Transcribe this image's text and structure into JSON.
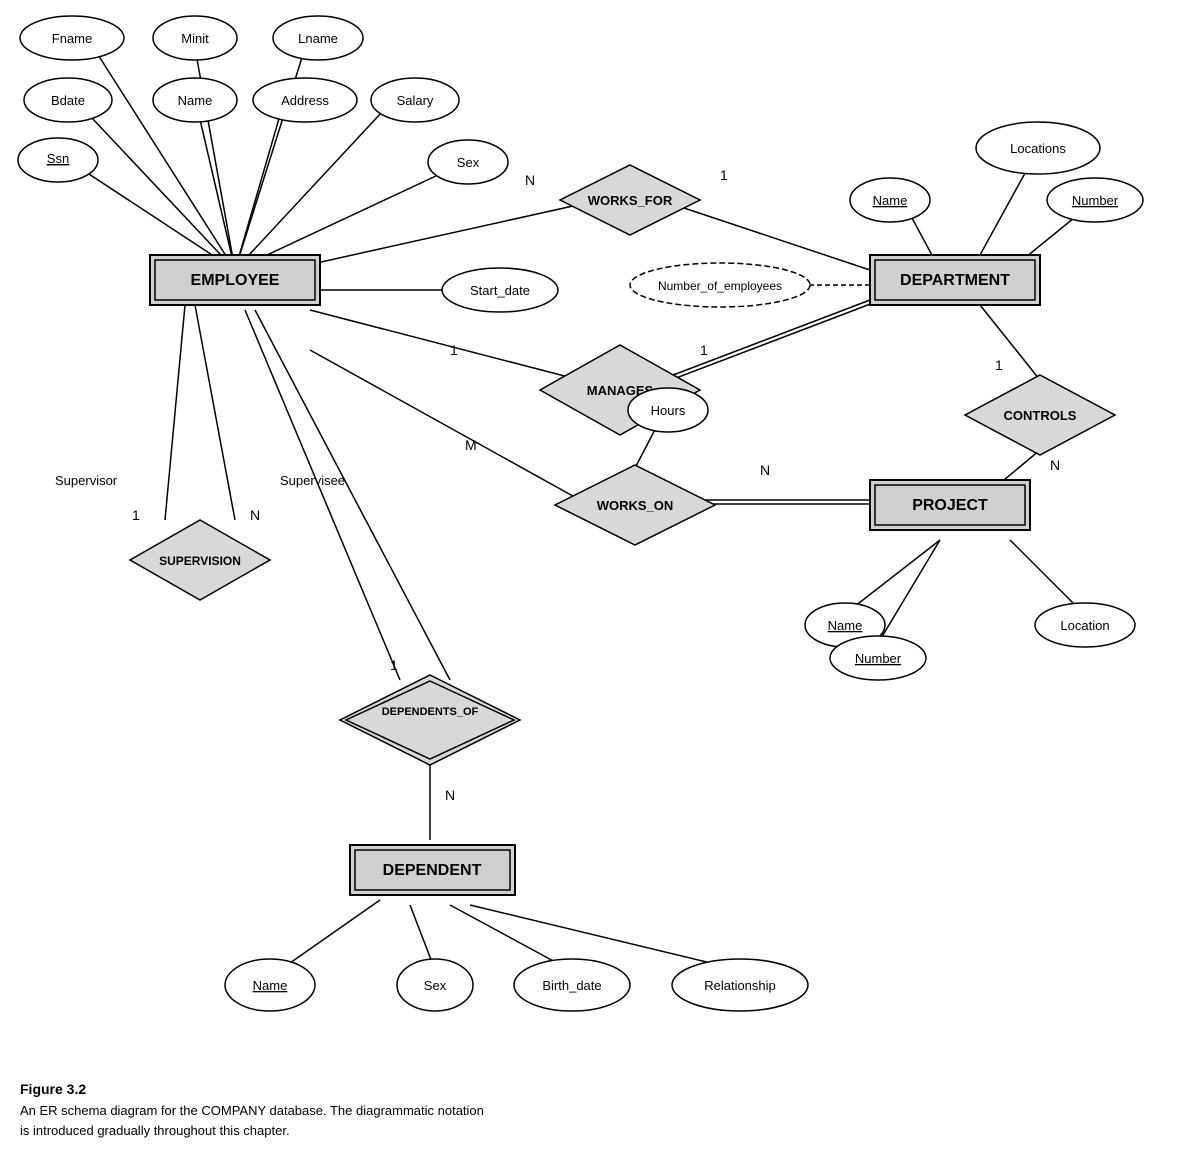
{
  "diagram": {
    "title": "Figure 3.2",
    "caption_line1": "An ER schema diagram for the COMPANY database. The diagrammatic notation",
    "caption_line2": "is introduced gradually throughout this chapter."
  },
  "entities": {
    "employee": "EMPLOYEE",
    "department": "DEPARTMENT",
    "project": "PROJECT",
    "dependent": "DEPENDENT"
  },
  "relationships": {
    "works_for": "WORKS_FOR",
    "manages": "MANAGES",
    "works_on": "WORKS_ON",
    "controls": "CONTROLS",
    "supervision": "SUPERVISION",
    "dependents_of": "DEPENDENTS_OF"
  },
  "attributes": {
    "fname": "Fname",
    "minit": "Minit",
    "lname": "Lname",
    "bdate": "Bdate",
    "name_emp": "Name",
    "address": "Address",
    "salary": "Salary",
    "ssn": "Ssn",
    "sex_emp": "Sex",
    "start_date": "Start_date",
    "number_of_employees": "Number_of_employees",
    "locations": "Locations",
    "dept_name": "Name",
    "dept_number": "Number",
    "hours": "Hours",
    "proj_name": "Name",
    "proj_number": "Number",
    "location": "Location",
    "dep_name": "Name",
    "dep_sex": "Sex",
    "birth_date": "Birth_date",
    "relationship": "Relationship"
  },
  "cardinalities": {
    "works_for_n": "N",
    "works_for_1": "1",
    "manages_1_emp": "1",
    "manages_1_dept": "1",
    "works_on_m": "M",
    "works_on_n": "N",
    "controls_1": "1",
    "controls_n": "N",
    "supervision_1": "1",
    "supervision_n": "N",
    "supervisee_label": "Supervisee",
    "supervisor_label": "Supervisor",
    "dependents_of_1": "1",
    "dependents_of_n": "N"
  }
}
